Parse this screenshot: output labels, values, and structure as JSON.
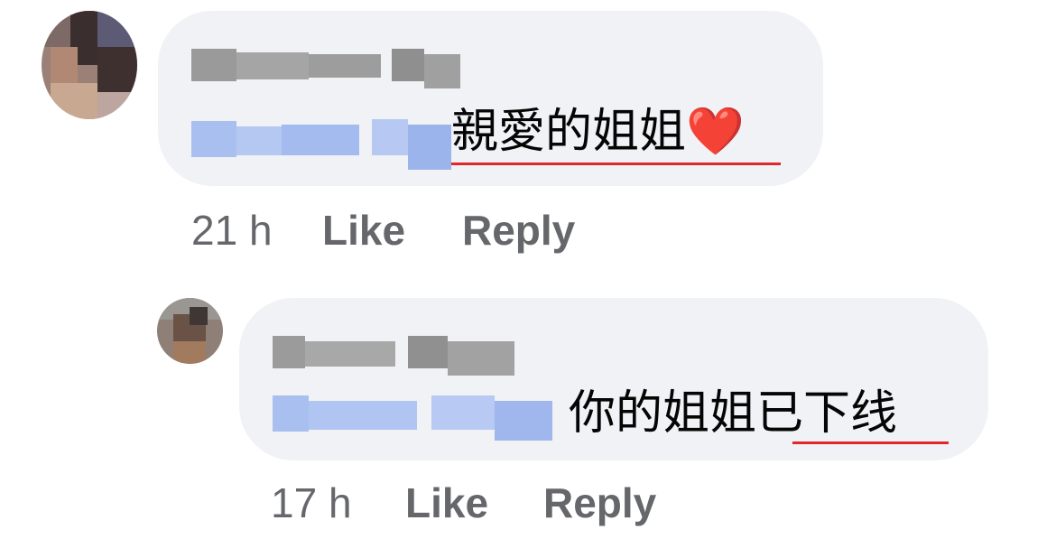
{
  "comments": [
    {
      "author_name": "",
      "mention": "",
      "text": "親愛的姐姐❤️",
      "time": "21 h",
      "like_label": "Like",
      "reply_label": "Reply"
    },
    {
      "author_name": "",
      "mention": "",
      "text": "你的姐姐已下线",
      "time": "17 h",
      "like_label": "Like",
      "reply_label": "Reply"
    }
  ],
  "colors": {
    "bubble_bg": "#f0f2f5",
    "meta_text": "#65676b",
    "mention_blue": "#9db5ec",
    "name_gray": "#8a8a8a",
    "spellcheck_underline": "#e0272d"
  }
}
